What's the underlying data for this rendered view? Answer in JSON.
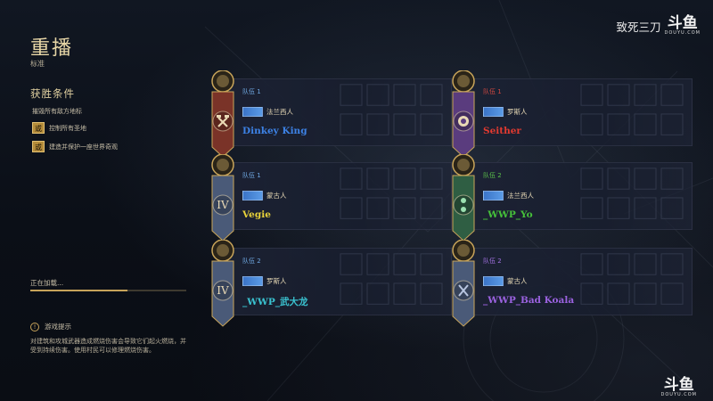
{
  "page": {
    "title": "重播",
    "subtitle": "标准",
    "conditions_title": "获胜条件",
    "conditions": [
      {
        "text": "摧毁所有敌方地标",
        "prefix": ""
      },
      {
        "text": "控制所有圣地",
        "prefix": "或"
      },
      {
        "text": "建造并保护一座世界奇观",
        "prefix": "或"
      }
    ],
    "loading_text": "正在加载...",
    "loading_progress": 0.62,
    "tip_title": "游戏提示",
    "tip_text": "对建筑和攻城武器造成燃烧伤害会导致它们起火燃烧，并受到持续伤害。使用村民可以修理燃烧伤害。"
  },
  "players": [
    {
      "team": "队伍 1",
      "team_color": "#6ea6e0",
      "civ": "法兰西人",
      "name": "Dinkey King",
      "name_color": "#3d82e6",
      "banner": "#7a3328",
      "emblem": "hammer-icon"
    },
    {
      "team": "队伍 1",
      "team_color": "#d04840",
      "civ": "罗斯人",
      "name": "Seither",
      "name_color": "#e23a30",
      "banner": "#5a3c7e",
      "emblem": "lion-icon"
    },
    {
      "team": "队伍 1",
      "team_color": "#6ea6e0",
      "civ": "蒙古人",
      "name": "Vegie",
      "name_color": "#e8d23a",
      "banner": "#4a5a78",
      "emblem": "roman-four-icon"
    },
    {
      "team": "队伍 2",
      "team_color": "#5ac04a",
      "civ": "法兰西人",
      "name": "_WWP_Yo",
      "name_color": "#46c23a",
      "banner": "#2f5e43",
      "emblem": "dots-icon"
    },
    {
      "team": "队伍 2",
      "team_color": "#6ea6e0",
      "civ": "罗斯人",
      "name": "_WWP_武大龙",
      "name_color": "#3ac2d0",
      "banner": "#4a5a78",
      "emblem": "roman-four-icon"
    },
    {
      "team": "队伍 2",
      "team_color": "#a070e0",
      "civ": "蒙古人",
      "name": "_WWP_Bad Koala",
      "name_color": "#9b62e0",
      "banner": "#4a5a78",
      "emblem": "cross-swords-icon"
    }
  ],
  "watermark": {
    "top_text": "致死三刀",
    "logo": "斗鱼",
    "url": "DOUYU.COM"
  }
}
